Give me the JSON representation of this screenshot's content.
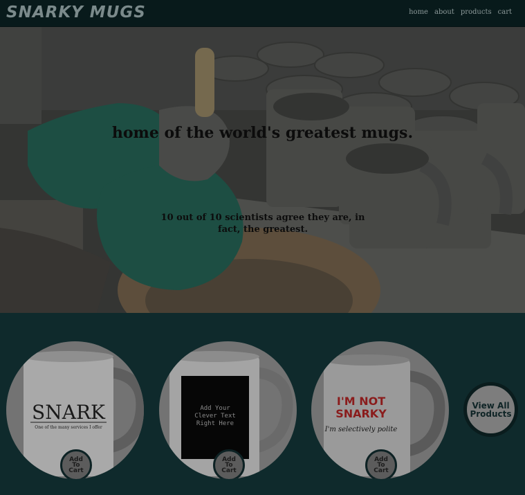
{
  "nav": {
    "logo": "SNARKY MUGS",
    "links": [
      {
        "label": "home"
      },
      {
        "label": "about"
      },
      {
        "label": "products"
      },
      {
        "label": "cart"
      }
    ]
  },
  "hero": {
    "title": "home of the world's greatest mugs.",
    "subtitle": "10 out of 10 scientists agree they are, in fact, the greatest."
  },
  "products": [
    {
      "mug_line1": "SNARK",
      "mug_line2": "One of the many services I offer",
      "button": "Add To Cart"
    },
    {
      "mug_line1": "Add Your",
      "mug_line2": "Clever Text",
      "mug_line3": "Right Here",
      "button": "Add To Cart"
    },
    {
      "mug_line1": "I'M NOT",
      "mug_line2": "SNARKY",
      "mug_line3": "I'm selectively polite",
      "button": "Add To Cart"
    }
  ],
  "view_all": {
    "label": "View All Products"
  },
  "colors": {
    "nav_bg": "#081a1b",
    "page_bg": "#0f2a2c",
    "glove": "#1f5a4c",
    "mug_red": "#8a1c1c"
  }
}
